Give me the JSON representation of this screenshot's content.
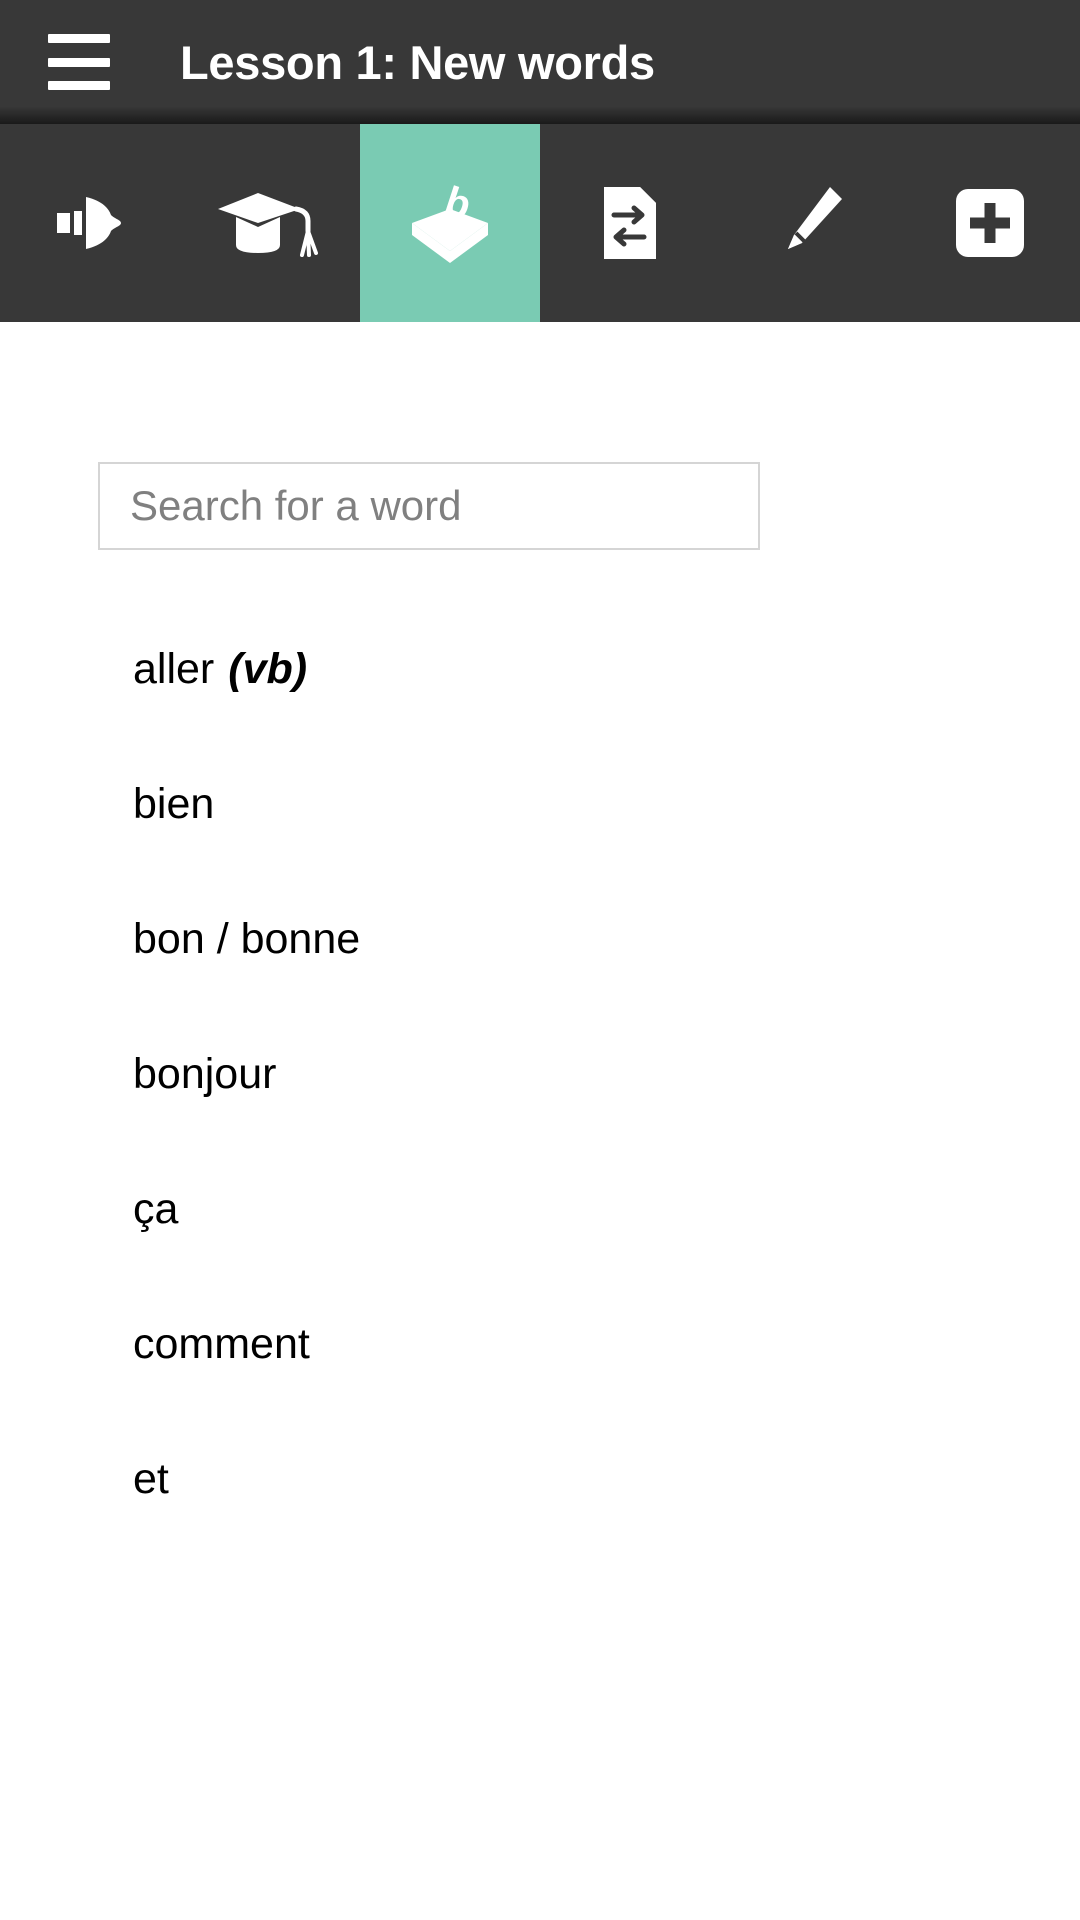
{
  "header": {
    "title": "Lesson 1: New words",
    "menu_icon": "hamburger-menu-icon",
    "background": "#383838"
  },
  "tabbar": {
    "active_color": "#7acbb3",
    "background": "#383838",
    "tabs": [
      {
        "id": "pronunciation",
        "icon": "speaker-icon",
        "label": "Pronunciation",
        "active": false
      },
      {
        "id": "grammar",
        "icon": "graduation-cap-icon",
        "label": "Grammar",
        "active": false
      },
      {
        "id": "vocabulary",
        "icon": "word-box-icon",
        "label": "Vocabulary",
        "active": true
      },
      {
        "id": "translate",
        "icon": "translate-doc-icon",
        "label": "Translate",
        "active": false
      },
      {
        "id": "notes",
        "icon": "pencil-icon",
        "label": "Notes",
        "active": false
      },
      {
        "id": "add",
        "icon": "plus-square-icon",
        "label": "Add",
        "active": false
      }
    ]
  },
  "search": {
    "placeholder": "Search for a word",
    "value": ""
  },
  "words": [
    {
      "term": "aller",
      "pos": "(vb)"
    },
    {
      "term": "bien",
      "pos": ""
    },
    {
      "term": "bon / bonne",
      "pos": ""
    },
    {
      "term": "bonjour",
      "pos": ""
    },
    {
      "term": "ça",
      "pos": ""
    },
    {
      "term": "comment",
      "pos": ""
    },
    {
      "term": "et",
      "pos": ""
    }
  ]
}
